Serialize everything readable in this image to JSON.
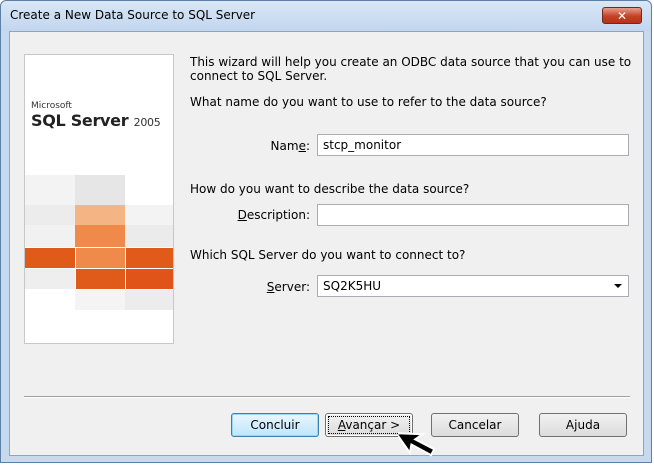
{
  "window": {
    "title": "Create a New Data Source to SQL Server",
    "close_label": "✕"
  },
  "banner": {
    "brand": "Microsoft",
    "product": "SQL Server",
    "version": "2005"
  },
  "intro": {
    "line1": "This wizard will help you create an ODBC data source that you can use to",
    "line2": "connect to SQL Server."
  },
  "name_section": {
    "question": "What name do you want to use to refer to the data source?",
    "label_prefix": "Nam",
    "label_key": "e",
    "label_suffix": ":",
    "value": "stcp_monitor"
  },
  "description_section": {
    "question": "How do you want to describe the data source?",
    "label_key": "D",
    "label_rest": "escription:",
    "value": ""
  },
  "server_section": {
    "question": "Which SQL Server do you want to connect to?",
    "label_key": "S",
    "label_rest": "erver:",
    "value": "SQ2K5HU"
  },
  "buttons": {
    "finish": "Concluir",
    "next_key": "A",
    "next_rest": "vançar >",
    "cancel": "Cancelar",
    "help_key": "j",
    "help_prefix": "A",
    "help_rest": "uda"
  },
  "colors": {
    "orange_dark": "#e05a1a",
    "orange_mid": "#f08a4a",
    "orange_light": "#f4b483",
    "gray_tile": "#e4e4e4"
  }
}
